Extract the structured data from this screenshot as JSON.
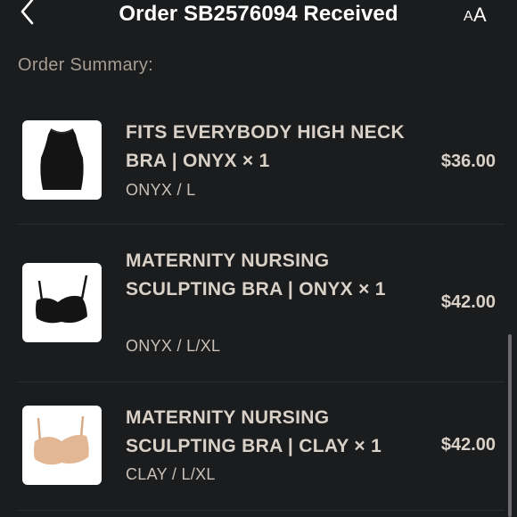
{
  "header": {
    "back_icon": "chevron-left-icon",
    "title": "Order SB2576094 Received",
    "text_size_small": "A",
    "text_size_large": "A"
  },
  "summary_label": "Order Summary:",
  "items": [
    {
      "name": "FITS EVERYBODY HIGH NECK BRA | ONYX × 1",
      "variant": "ONYX / L",
      "price": "$36.00",
      "product_color": "#141414"
    },
    {
      "name": "MATERNITY NURSING SCULPTING BRA | ONYX × 1",
      "variant": "ONYX / L/XL",
      "price": "$42.00",
      "product_color": "#141414"
    },
    {
      "name": "MATERNITY NURSING SCULPTING BRA | CLAY × 1",
      "variant": "CLAY / L/XL",
      "price": "$42.00",
      "product_color": "#e3b793"
    }
  ],
  "colors": {
    "background": "#1b1c1e",
    "text": "#d9d1c7",
    "muted": "#a69d92"
  }
}
